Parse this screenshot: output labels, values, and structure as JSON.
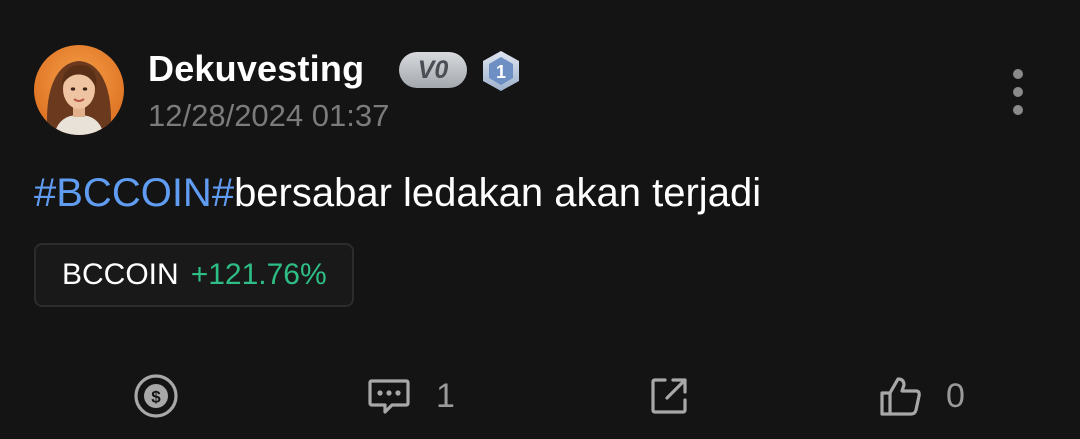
{
  "post": {
    "author": {
      "name": "Dekuvesting",
      "level_badge": "V0",
      "rank_badge": "1"
    },
    "timestamp": "12/28/2024 01:37",
    "content": {
      "hashtag": "#BCCOIN#",
      "text": "bersabar ledakan akan terjadi"
    },
    "ticker": {
      "symbol": "BCCOIN",
      "change": "+121.76%"
    },
    "actions": {
      "comment_count": "1",
      "like_count": "0"
    },
    "icons": {
      "more": "more-vertical-icon",
      "tip": "coin-tip-icon",
      "comment": "comment-icon",
      "share": "share-icon",
      "like": "thumbs-up-icon"
    },
    "colors": {
      "background": "#141414",
      "hashtag": "#5f9cf2",
      "positive": "#2ebd85",
      "muted": "#7b7b7b"
    }
  }
}
